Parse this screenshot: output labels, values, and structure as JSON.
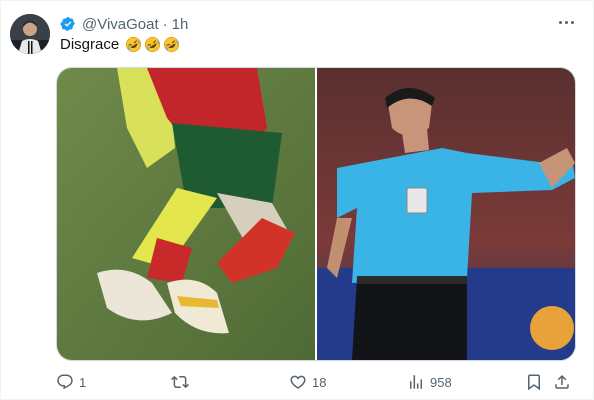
{
  "tweet": {
    "handle": "@VivaGoat",
    "separator": "·",
    "time": "1h",
    "text": "Disgrace",
    "emojis": [
      "rolling-on-floor-laughing",
      "rolling-on-floor-laughing",
      "rolling-on-floor-laughing"
    ]
  },
  "media": {
    "left_image": "soccer-player-legs-red-socks",
    "right_image": "referee-in-blue-shirt-pointing"
  },
  "actions": {
    "replies": "1",
    "retweets": "",
    "likes": "18",
    "views": "958"
  },
  "colors": {
    "text": "#0f1419",
    "secondary": "#536471",
    "verified": "#1d9bf0",
    "border": "#cfd9de"
  }
}
